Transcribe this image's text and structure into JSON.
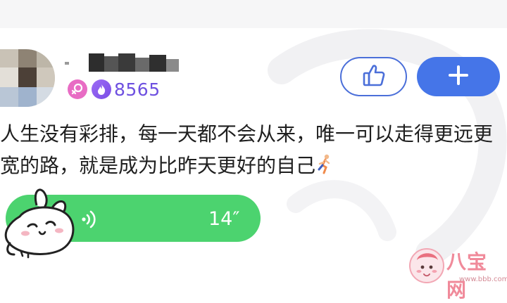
{
  "post": {
    "fire_score": "8565",
    "text": "人生没有彩排，每一天都不会从来，唯一可以走得更远更\n宽的路，就是成为比昨天更好的自己"
  },
  "voice": {
    "duration": "14″"
  },
  "buttons": {
    "like_icon": "thumbs-up-icon",
    "add_icon": "plus-icon"
  },
  "watermark": {
    "brand": "八宝网",
    "url": "www.bbb.com"
  },
  "colors": {
    "like_border": "#4b6fd9",
    "add_fill": "#4575e8",
    "voice_fill": "#4cd36f",
    "score_text": "#6e50e0",
    "gender_badge": "#e86cc4"
  }
}
